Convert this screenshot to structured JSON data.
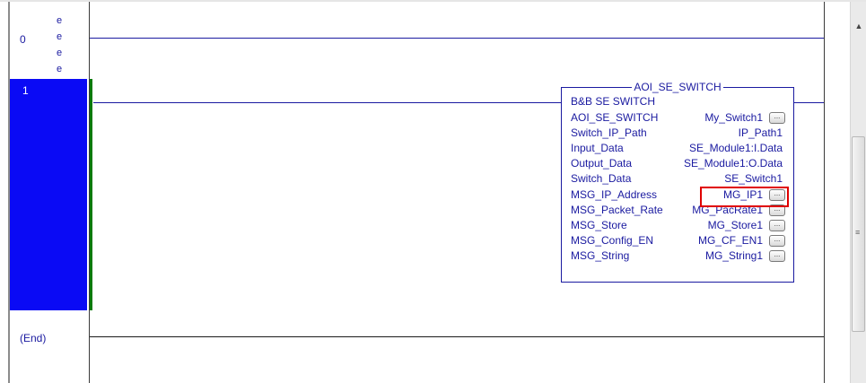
{
  "rungs": [
    {
      "number": "0",
      "edit_markers": [
        "e",
        "e",
        "e",
        "e"
      ]
    },
    {
      "number": "1",
      "selected": true
    }
  ],
  "end_label": "(End)",
  "aoi_block": {
    "title": "AOI_SE_SWITCH",
    "description": "B&B SE SWITCH",
    "parameters": [
      {
        "name": "AOI_SE_SWITCH",
        "value": "My_Switch1",
        "has_button": true
      },
      {
        "name": "Switch_IP_Path",
        "value": "IP_Path1",
        "has_button": false
      },
      {
        "name": "Input_Data",
        "value": "SE_Module1:I.Data",
        "has_button": false
      },
      {
        "name": "Output_Data",
        "value": "SE_Module1:O.Data",
        "has_button": false
      },
      {
        "name": "Switch_Data",
        "value": "SE_Switch1",
        "has_button": false
      },
      {
        "name": "MSG_IP_Address",
        "value": "MG_IP1",
        "has_button": true
      },
      {
        "name": "MSG_Packet_Rate",
        "value": "MG_PacRate1",
        "has_button": true
      },
      {
        "name": "MSG_Store",
        "value": "MG_Store1",
        "has_button": true
      },
      {
        "name": "MSG_Config_EN",
        "value": "MG_CF_EN1",
        "has_button": true
      },
      {
        "name": "MSG_String",
        "value": "MG_String1",
        "has_button": true
      }
    ],
    "button_glyph": "..."
  },
  "icons": {
    "scroll_up": "▲",
    "scroll_grip": "≡"
  },
  "colors": {
    "wire": "#1a1aa0",
    "selection": "#0a0af5",
    "highlight": "#e00000"
  }
}
